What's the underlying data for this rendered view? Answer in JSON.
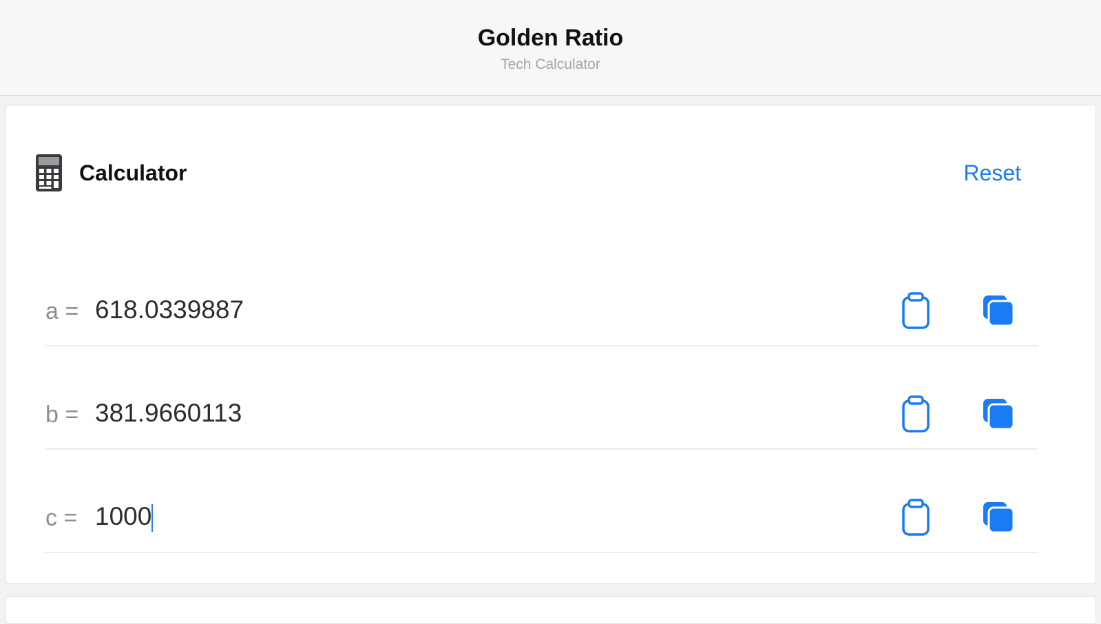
{
  "header": {
    "title": "Golden Ratio",
    "subtitle": "Tech Calculator"
  },
  "card": {
    "icon": "calculator-icon",
    "title": "Calculator",
    "reset_label": "Reset"
  },
  "rows": [
    {
      "label": "a =",
      "value": "618.0339887",
      "paste_icon": "clipboard-icon",
      "copy_icon": "copy-icon"
    },
    {
      "label": "b =",
      "value": "381.9660113",
      "paste_icon": "clipboard-icon",
      "copy_icon": "copy-icon"
    },
    {
      "label": "c =",
      "value": "1000",
      "paste_icon": "clipboard-icon",
      "copy_icon": "copy-icon"
    }
  ],
  "colors": {
    "accent": "#1a7cf5"
  }
}
